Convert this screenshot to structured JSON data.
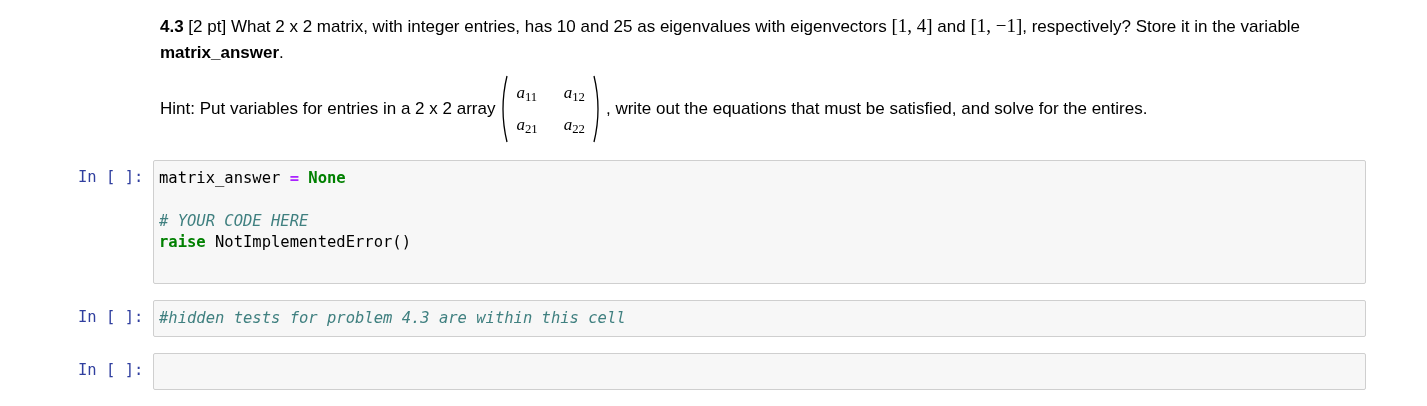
{
  "markdown": {
    "question": [
      {
        "kind": "text",
        "text": "**4.3** [2 pt] What 2 x 2 matrix, with integer entries, has 10 and 25 as eigenvalues with eigenvectors "
      },
      {
        "kind": "math",
        "text": "[1, 4]"
      },
      {
        "kind": "text",
        "text": " and "
      },
      {
        "kind": "math",
        "text": "[1, −1]"
      },
      {
        "kind": "text",
        "text": ", respectively? Store it in the variable **matrix_answer**."
      }
    ],
    "hint_before": "Hint: Put variables for entries in a 2 x 2 array",
    "matrix": [
      [
        "*a*$_{11}$",
        "*a*$_{12}$"
      ],
      [
        "*a*$_{21}$",
        "*a*$_{22}$"
      ]
    ],
    "hint_after": ", write out the equations that must be satisfied, and solve for the entires."
  },
  "cells": [
    {
      "prompt": "In [ ]:",
      "blank_after": true,
      "lines": [
        {
          "tokens": [
            {
              "kind": "name",
              "text": "matrix_answer "
            },
            {
              "kind": "op",
              "text": "="
            },
            {
              "kind": "keyword",
              "text": " None"
            }
          ]
        },
        {
          "blank_before": true,
          "tokens": [
            {
              "kind": "comment",
              "text": "# YOUR CODE HERE"
            }
          ]
        },
        {
          "tokens": [
            {
              "kind": "keyword",
              "text": "raise"
            },
            {
              "kind": "name",
              "text": " NotImplementedError()"
            }
          ]
        }
      ]
    },
    {
      "prompt": "In [ ]:",
      "lines": [
        {
          "tokens": [
            {
              "kind": "comment",
              "text": "#hidden tests for problem 4.3 are within this cell"
            }
          ]
        }
      ]
    },
    {
      "prompt": "In [ ]:"
    }
  ]
}
